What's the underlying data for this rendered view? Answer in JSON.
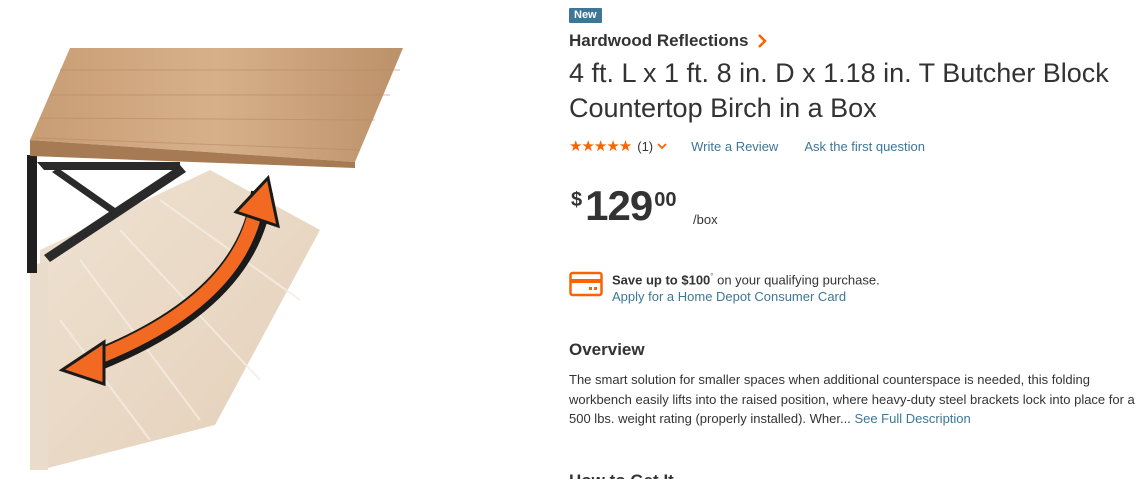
{
  "product": {
    "badge": "New",
    "brand": "Hardwood Reflections",
    "title": "4 ft. L x 1 ft. 8 in. D x 1.18 in. T Butcher Block Countertop Birch in a Box",
    "rating": {
      "stars": "★★★★★",
      "count": "(1)",
      "write_review": "Write a Review",
      "ask_question": "Ask the first question"
    },
    "price": {
      "currency": "$",
      "dollars": "129",
      "cents": "00",
      "unit": "/box"
    },
    "card_promo": {
      "save_prefix": "Save up to ",
      "save_amount": "$100",
      "save_suffix": " on your qualifying purchase.",
      "footnote": "°",
      "apply_link": "Apply for a Home Depot Consumer Card"
    },
    "overview": {
      "heading": "Overview",
      "text": "The smart solution for smaller spaces when additional counterspace is needed, this folding workbench easily lifts into the raised position, where heavy-duty steel brackets lock into place for a 500 lbs. weight rating (properly installed). Wher...",
      "see_full": "See Full Description"
    },
    "next_heading": "How to Get It"
  },
  "colors": {
    "accent_orange": "#f96302",
    "link_blue": "#3e7697",
    "text": "#333333"
  },
  "icons": {
    "brand_chevron": "chevron-right-icon",
    "review_chevron": "chevron-down-icon",
    "card": "credit-card-icon",
    "rotate_arrow": "double-arrow-icon"
  }
}
